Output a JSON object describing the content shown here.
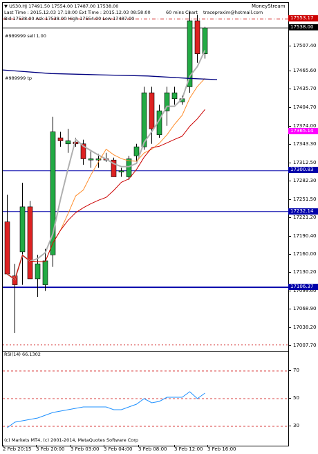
{
  "header": {
    "symbol_line": "▼ US30.HJ  17491.50 17554.00 17487.00 17538.00",
    "last_time_line": "Last Time : 2015.12.03  17:18:00      Ext    Time : 2015.12.03 08:58:00",
    "bid_line": "Bid 17538.00 Ask  17538.00 High 17554.00  Low 17487.00",
    "timeframe_note": "60 mins Chart",
    "email": "traceproxim@hotmail.com",
    "brand": "MoneyStream"
  },
  "line_labels": {
    "alert_line": "#989999 sell 1.00",
    "tp_line": "#989999 tp"
  },
  "price_axis": {
    "ticks": [
      "17507.40",
      "17465.60",
      "17435.70",
      "17404.70",
      "17374.00",
      "17343.30",
      "17312.50",
      "17282.30",
      "17251.50",
      "17221.20",
      "17190.40",
      "17160.00",
      "17130.20",
      "17099.60",
      "17068.90",
      "17038.20",
      "17007.70"
    ],
    "labels": [
      {
        "text": "17553.17",
        "color": "#cc0000"
      },
      {
        "text": "17538.00",
        "color": "#000000"
      },
      {
        "text": "17365.14",
        "color": "#ff00ff"
      },
      {
        "text": "17300.83",
        "color": "#0000aa"
      },
      {
        "text": "17232.14",
        "color": "#0000aa"
      },
      {
        "text": "17106.37",
        "color": "#0000aa"
      }
    ]
  },
  "rsi": {
    "title": "RSI(14) 66.1302",
    "ticks": [
      "70",
      "50",
      "30"
    ],
    "footer": "(c) Markets MT4, (c) 2001-2014, MetaQuotes Software Corp"
  },
  "time_axis": {
    "ticks": [
      "2 Feb 20:15",
      "3 Feb 20:00",
      "3 Feb 03:00",
      "3 Feb 04:00",
      "3 Feb 08:00",
      "3 Feb 12:00",
      "3 Feb 16:00"
    ]
  },
  "chart_data": {
    "type": "candlestick",
    "ylim": [
      17000,
      17580
    ],
    "candles": [
      {
        "open": 17215,
        "high": 17260,
        "low": 17150,
        "close": 17128
      },
      {
        "open": 17125,
        "high": 17145,
        "low": 17030,
        "close": 17110
      },
      {
        "open": 17165,
        "high": 17280,
        "low": 17110,
        "close": 17240
      },
      {
        "open": 17240,
        "high": 17250,
        "low": 17130,
        "close": 17120
      },
      {
        "open": 17120,
        "high": 17160,
        "low": 17090,
        "close": 17145
      },
      {
        "open": 17110,
        "high": 17170,
        "low": 17100,
        "close": 17150
      },
      {
        "open": 17160,
        "high": 17390,
        "low": 17140,
        "close": 17365
      },
      {
        "open": 17355,
        "high": 17365,
        "low": 17340,
        "close": 17350
      },
      {
        "open": 17345,
        "high": 17370,
        "low": 17330,
        "close": 17350
      },
      {
        "open": 17348,
        "high": 17355,
        "low": 17340,
        "close": 17345
      },
      {
        "open": 17345,
        "high": 17352,
        "low": 17310,
        "close": 17320
      },
      {
        "open": 17318,
        "high": 17335,
        "low": 17305,
        "close": 17320
      },
      {
        "open": 17318,
        "high": 17328,
        "low": 17305,
        "close": 17320
      },
      {
        "open": 17320,
        "high": 17330,
        "low": 17315,
        "close": 17318
      },
      {
        "open": 17318,
        "high": 17322,
        "low": 17290,
        "close": 17290
      },
      {
        "open": 17298,
        "high": 17305,
        "low": 17290,
        "close": 17300
      },
      {
        "open": 17290,
        "high": 17325,
        "low": 17285,
        "close": 17320
      },
      {
        "open": 17325,
        "high": 17345,
        "low": 17315,
        "close": 17340
      },
      {
        "open": 17340,
        "high": 17440,
        "low": 17335,
        "close": 17430
      },
      {
        "open": 17430,
        "high": 17440,
        "low": 17345,
        "close": 17370
      },
      {
        "open": 17360,
        "high": 17410,
        "low": 17355,
        "close": 17400
      },
      {
        "open": 17400,
        "high": 17440,
        "low": 17375,
        "close": 17430
      },
      {
        "open": 17420,
        "high": 17440,
        "low": 17410,
        "close": 17430
      },
      {
        "open": 17415,
        "high": 17425,
        "low": 17410,
        "close": 17420
      },
      {
        "open": 17440,
        "high": 17565,
        "low": 17430,
        "close": 17550
      },
      {
        "open": 17550,
        "high": 17560,
        "low": 17480,
        "close": 17495
      },
      {
        "open": 17495,
        "high": 17540,
        "low": 17487,
        "close": 17538
      }
    ],
    "rsi_values": [
      29,
      33,
      34,
      35,
      36,
      38,
      40,
      41,
      42,
      43,
      44,
      44,
      44,
      44,
      42,
      42,
      44,
      46,
      50,
      47,
      48,
      51,
      51,
      51,
      55,
      50,
      54
    ]
  },
  "colors": {
    "bull": "#22aa44",
    "bear": "#dd2222",
    "ma_fast": "#b0b0b0",
    "ma_mid": "#ff8c2a",
    "ma_slow": "#cc0000",
    "ma_long": "#00007f",
    "hline_blue": "#0000aa",
    "hline_red": "#cc0000",
    "rsi": "#1e90ff"
  }
}
